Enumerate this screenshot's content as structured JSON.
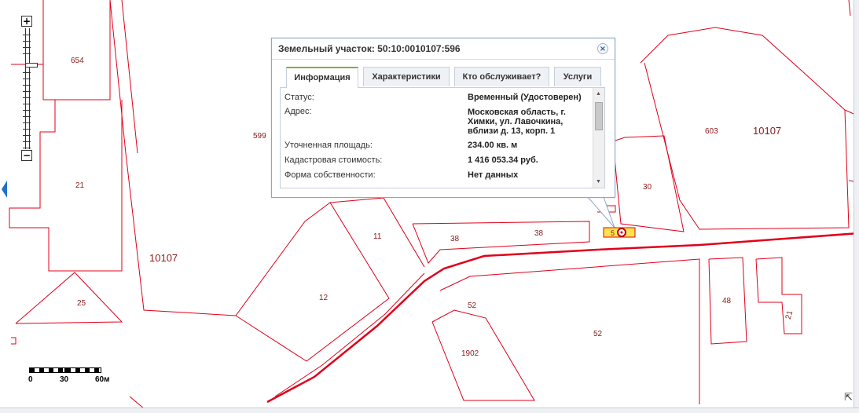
{
  "map": {
    "labels": {
      "p654": "654",
      "p21": "21",
      "p599": "599",
      "block_left": "10107",
      "p25": "25",
      "p12": "12",
      "p11": "11",
      "p38a": "38",
      "p38b": "38",
      "p52a": "52",
      "p52b": "52",
      "p1902": "1902",
      "p30": "30",
      "p603": "603",
      "block_right": "10107",
      "p48": "48",
      "p21b": "21",
      "marker": "5"
    },
    "colors": {
      "parcel_line": "#e0001a",
      "road_line": "#e0001a",
      "label_text": "#8b1a1a",
      "marker_fill": "#ffe34d"
    },
    "zoom_plus": "+",
    "zoom_minus": "−",
    "scale": {
      "l0": "0",
      "l1": "30",
      "l2": "60м"
    }
  },
  "popup": {
    "title": "Земельный участок: 50:10:0010107:596",
    "close_icon": "×",
    "tabs": [
      "Информация",
      "Характеристики",
      "Кто обслуживает?",
      "Услуги"
    ],
    "rows": [
      {
        "label": "Статус:",
        "value": "Временный (Удостоверен)"
      },
      {
        "label": "Адрес:",
        "value": "Московская область, г. Химки, ул. Лавочкина, вблизи д. 13, корп. 1"
      },
      {
        "label": "Уточненная площадь:",
        "value": "234.00 кв. м"
      },
      {
        "label": "Кадастровая стоимость:",
        "value": "1 416 053.34 руб."
      },
      {
        "label": "Форма собственности:",
        "value": "Нет данных"
      }
    ]
  }
}
